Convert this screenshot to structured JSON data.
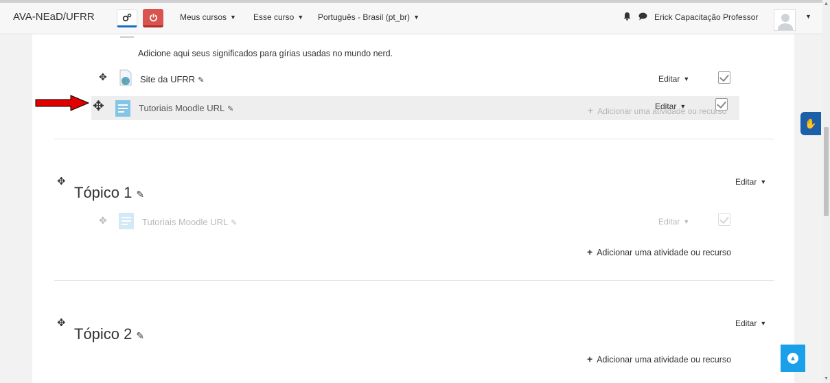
{
  "navbar": {
    "brand": "AVA-NEaD/UFRR",
    "menus": [
      "Meus cursos",
      "Esse curso",
      "Português - Brasil (pt_br)"
    ],
    "user_name": "Erick Capacitação Professor",
    "icons": [
      "gear-icon",
      "power-icon",
      "bell-icon",
      "chat-icon",
      "avatar",
      "caret-down-icon"
    ]
  },
  "section0": {
    "description": "Adicione aqui seus significados para gírias usadas no mundo nerd.",
    "activities": [
      {
        "label": "Site da UFRR",
        "edit": "Editar",
        "type": "url"
      },
      {
        "label": "Tutoriais Moodle URL",
        "edit": "Editar",
        "type": "page",
        "state": "dragging"
      }
    ],
    "add_activity": "Adicionar uma atividade ou recurso"
  },
  "topics": [
    {
      "title": "Tópico 1",
      "edit": "Editar",
      "activities": [
        {
          "label": "Tutoriais Moodle URL",
          "edit": "Editar",
          "state": "placeholder"
        }
      ],
      "add_activity": "Adicionar uma atividade ou recurso"
    },
    {
      "title": "Tópico 2",
      "edit": "Editar",
      "add_activity": "Adicionar uma atividade ou recurso"
    }
  ],
  "colors": {
    "accent": "#0f6fc5",
    "danger": "#d9534f",
    "back_to_top": "#1a9fea",
    "accessibility": "#1b5fa8",
    "arrow": "#e00000"
  }
}
